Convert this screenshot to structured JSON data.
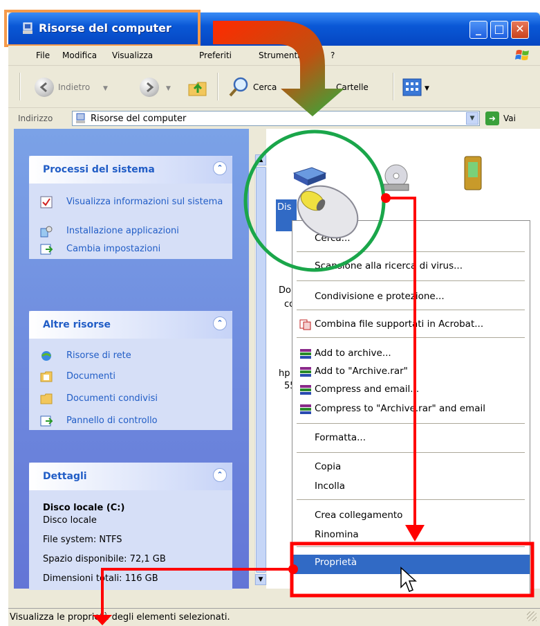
{
  "window": {
    "title": "Risorse del computer",
    "controls": {
      "minimize": "_",
      "maximize": "□",
      "close": "✕"
    }
  },
  "menubar": {
    "items": [
      "File",
      "Modifica",
      "Visualizza",
      "Preferiti",
      "Strumenti",
      "?"
    ]
  },
  "toolbar": {
    "back": "Indietro",
    "search": "Cerca",
    "folders": "Cartelle"
  },
  "address": {
    "label": "Indirizzo",
    "value": "Risorse del computer",
    "go": "Vai"
  },
  "taskpane": {
    "system": {
      "title": "Processi del sistema",
      "items": [
        "Visualizza informazioni sul sistema",
        "Installazione applicazioni",
        "Cambia impostazioni"
      ]
    },
    "other": {
      "title": "Altre risorse",
      "items": [
        "Risorse di rete",
        "Documenti",
        "Documenti condivisi",
        "Pannello di controllo"
      ]
    },
    "details": {
      "title": "Dettagli",
      "name": "Disco locale (C:)",
      "type": "Disco locale",
      "fs": "File system: NTFS",
      "free": "Spazio disponibile: 72,1 GB",
      "total": "Dimensioni totali: 116 GB"
    }
  },
  "content": {
    "selected_label": "Dis",
    "partial_1": "Do",
    "partial_2": "co",
    "partial_3": "hp",
    "partial_4": "55"
  },
  "context_menu": {
    "items": [
      {
        "label": "Cerca..."
      },
      {
        "label": "Scansione alla ricerca di virus..."
      },
      {
        "label": "Condivisione e protezione..."
      },
      {
        "label": "Combina file supportati in Acrobat..."
      },
      {
        "label": "Add to archive..."
      },
      {
        "label": "Add to \"Archive.rar\""
      },
      {
        "label": "Compress and email..."
      },
      {
        "label": "Compress to \"Archive.rar\" and email"
      },
      {
        "label": "Formatta..."
      },
      {
        "label": "Copia"
      },
      {
        "label": "Incolla"
      },
      {
        "label": "Crea collegamento"
      },
      {
        "label": "Rinomina"
      },
      {
        "label": "Proprietà"
      }
    ]
  },
  "statusbar": {
    "text": "Visualizza le proprietà degli elementi selezionati."
  },
  "colors": {
    "titlebar": "#0a58d6",
    "highlight_orange": "#f59a4a",
    "annotation_red": "#ff0000",
    "annotation_green": "#1aa64a",
    "selection_blue": "#316ac5"
  }
}
